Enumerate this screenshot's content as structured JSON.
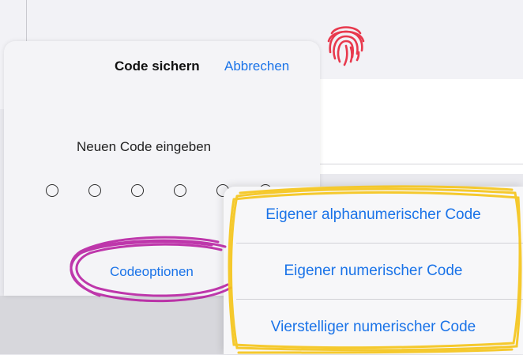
{
  "sheet": {
    "title": "Code sichern",
    "cancel_label": "Abbrechen",
    "prompt": "Neuen Code eingeben",
    "code_length": 6,
    "options_label": "Codeoptionen"
  },
  "popover": {
    "items": [
      {
        "label": "Eigener alphanumerischer Code"
      },
      {
        "label": "Eigener numerischer Code"
      },
      {
        "label": "Vierstelliger numerischer Code"
      }
    ]
  },
  "colors": {
    "accent": "#1a73e8",
    "fingerprint": "#e8394d",
    "annotation_purple": "#b5179e",
    "annotation_yellow": "#f5c518"
  },
  "icons": {
    "fingerprint": "fingerprint-icon"
  }
}
